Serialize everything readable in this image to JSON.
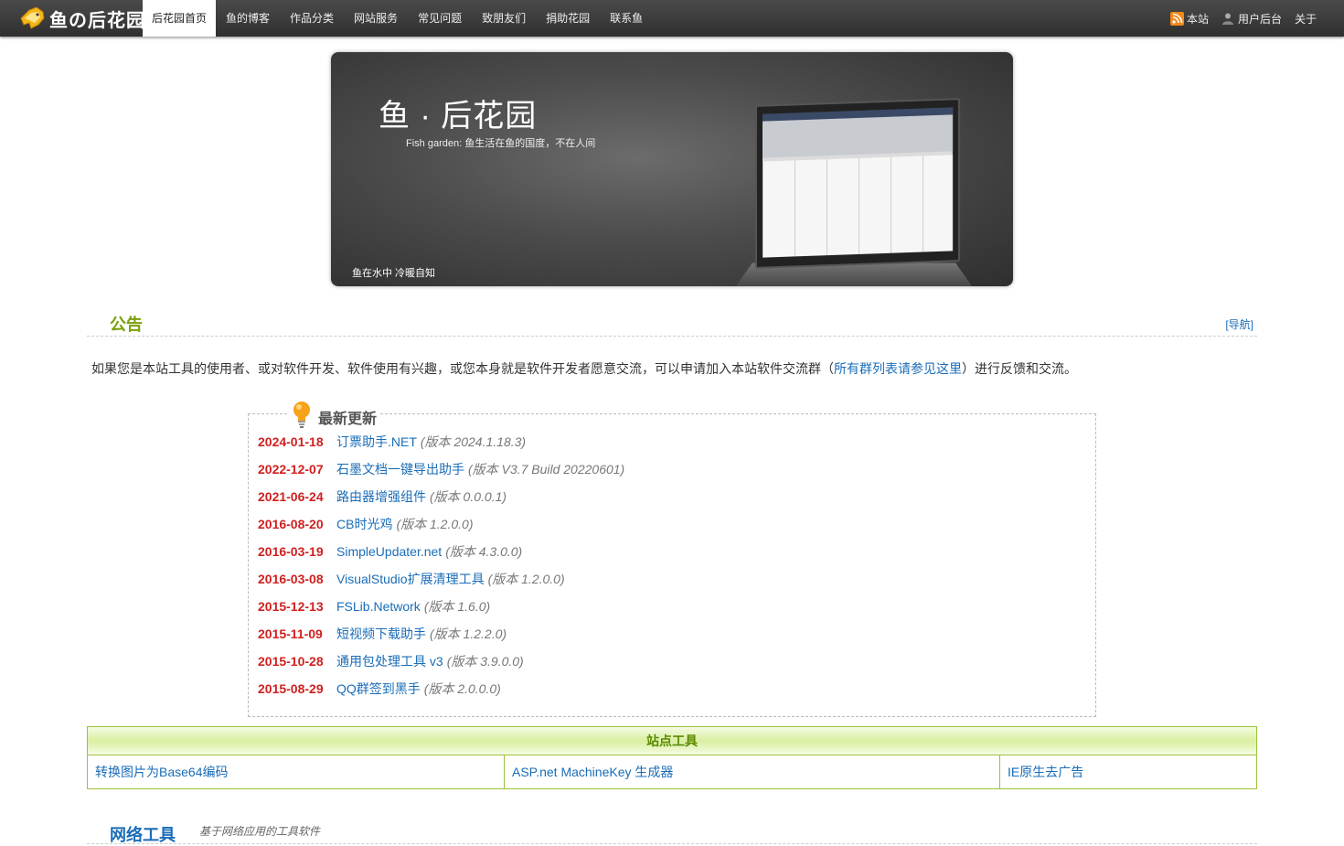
{
  "header": {
    "logo_text": "鱼の后花园",
    "nav": [
      {
        "label": "后花园首页",
        "active": true
      },
      {
        "label": "鱼的博客"
      },
      {
        "label": "作品分类"
      },
      {
        "label": "网站服务"
      },
      {
        "label": "常见问题"
      },
      {
        "label": "致朋友们"
      },
      {
        "label": "捐助花园"
      },
      {
        "label": "联系鱼"
      }
    ],
    "right": {
      "rss_label": "本站",
      "user_label": "用户后台",
      "about_label": "关于"
    }
  },
  "banner": {
    "title": "鱼 · 后花园",
    "subtitle": "Fish garden: 鱼生活在鱼的国度，不在人间",
    "caption": "鱼在水中 冷暖自知"
  },
  "notice": {
    "title": "公告",
    "nav_link": "[导航]",
    "text_before": "如果您是本站工具的使用者、或对软件开发、软件使用有兴趣，或您本身就是软件开发者愿意交流，可以申请加入本站软件交流群（",
    "link_text": "所有群列表请参见这里",
    "text_after": "）进行反馈和交流。"
  },
  "updates": {
    "title": "最新更新",
    "items": [
      {
        "date": "2024-01-18",
        "name": "订票助手.NET",
        "version": "(版本 2024.1.18.3)"
      },
      {
        "date": "2022-12-07",
        "name": "石墨文档一键导出助手",
        "version": "(版本 V3.7 Build 20220601)"
      },
      {
        "date": "2021-06-24",
        "name": "路由器增强组件",
        "version": "(版本 0.0.0.1)"
      },
      {
        "date": "2016-08-20",
        "name": "CB时光鸡",
        "version": "(版本 1.2.0.0)"
      },
      {
        "date": "2016-03-19",
        "name": "SimpleUpdater.net",
        "version": "(版本 4.3.0.0)"
      },
      {
        "date": "2016-03-08",
        "name": "VisualStudio扩展清理工具",
        "version": "(版本 1.2.0.0)"
      },
      {
        "date": "2015-12-13",
        "name": "FSLib.Network",
        "version": "(版本 1.6.0)"
      },
      {
        "date": "2015-11-09",
        "name": "短视频下载助手",
        "version": "(版本 1.2.2.0)"
      },
      {
        "date": "2015-10-28",
        "name": "通用包处理工具 v3",
        "version": "(版本 3.9.0.0)"
      },
      {
        "date": "2015-08-29",
        "name": "QQ群签到黑手",
        "version": "(版本 2.0.0.0)"
      }
    ]
  },
  "site_tools": {
    "title": "站点工具",
    "items": [
      "转换图片为Base64编码",
      "ASP.net MachineKey 生成器",
      "IE原生去广告"
    ]
  },
  "net_tools": {
    "title": "网络工具",
    "subtitle": "基于网络应用的工具软件"
  },
  "colors": {
    "accent_green": "#7aa10b",
    "link_blue": "#1a6db8",
    "date_red": "#d12020"
  }
}
